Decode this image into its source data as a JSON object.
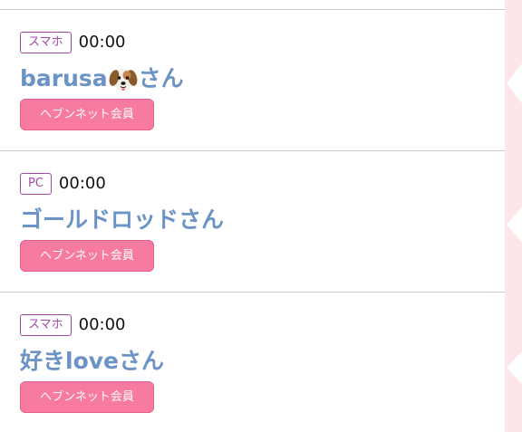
{
  "entries": [
    {
      "device": "スマホ",
      "time": "00:00",
      "name": "barusa",
      "name_icon": "dog-face-icon",
      "suffix": "さん",
      "member_label": "ヘブンネット会員"
    },
    {
      "device": "PC",
      "time": "00:00",
      "name": "ゴールドロッド",
      "suffix": "さん",
      "member_label": "ヘブンネット会員"
    },
    {
      "device": "スマホ",
      "time": "00:00",
      "name": "好きlove",
      "suffix": "さん",
      "member_label": "ヘブンネット会員"
    }
  ],
  "colors": {
    "badge_border": "#a34aa6",
    "name_text": "#6b93c6",
    "member_button": "#f77aa0",
    "side_panel": "#fde6ea"
  }
}
